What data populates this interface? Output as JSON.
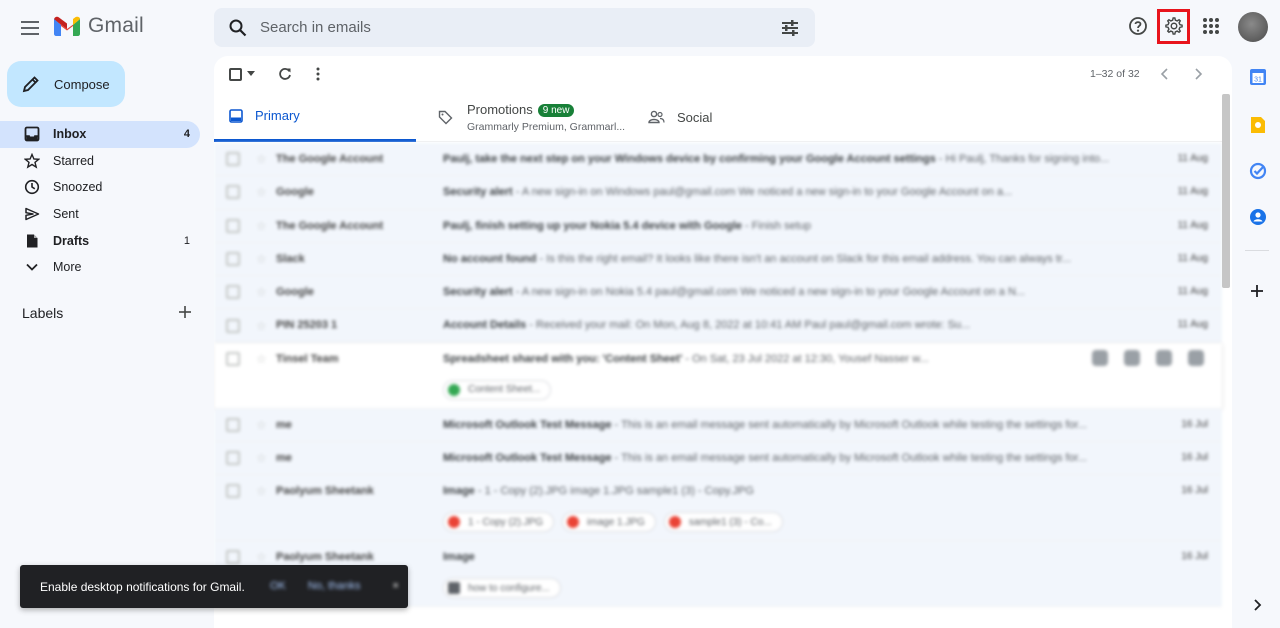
{
  "app": {
    "name": "Gmail"
  },
  "search": {
    "placeholder": "Search in emails"
  },
  "compose": {
    "label": "Compose"
  },
  "sidebar": {
    "items": [
      {
        "label": "Inbox",
        "count": "4",
        "icon": "inbox-icon"
      },
      {
        "label": "Starred",
        "count": "",
        "icon": "star-icon"
      },
      {
        "label": "Snoozed",
        "count": "",
        "icon": "clock-icon"
      },
      {
        "label": "Sent",
        "count": "",
        "icon": "send-icon"
      },
      {
        "label": "Drafts",
        "count": "1",
        "icon": "draft-icon"
      },
      {
        "label": "More",
        "count": "",
        "icon": "chevron-down-icon"
      }
    ],
    "labels_title": "Labels"
  },
  "toolbar": {
    "pager": "1–32 of 32"
  },
  "tabs": {
    "primary": "Primary",
    "promotions": "Promotions",
    "promotions_badge": "9 new",
    "promotions_sub": "Grammarly Premium, Grammarl...",
    "social": "Social"
  },
  "emails": [
    {
      "from": "The Google Account",
      "subject": "Paulj, take the next step on your Windows device by confirming your Google Account settings",
      "snippet": "Hi Paulj, Thanks for signing into...",
      "date": "11 Aug"
    },
    {
      "from": "Google",
      "subject": "Security alert",
      "snippet": "A new sign-in on Windows paul@gmail.com We noticed a new sign-in to your Google Account on a...",
      "date": "11 Aug"
    },
    {
      "from": "The Google Account",
      "subject": "Paulj, finish setting up your Nokia 5.4 device with Google",
      "snippet": "Finish setup",
      "date": "11 Aug"
    },
    {
      "from": "Slack",
      "subject": "No account found",
      "snippet": "Is this the right email? It looks like there isn't an account on Slack for this email address. You can always tr...",
      "date": "11 Aug"
    },
    {
      "from": "Google",
      "subject": "Security alert",
      "snippet": "A new sign-in on Nokia 5.4 paul@gmail.com We noticed a new sign-in to your Google Account on a N...",
      "date": "11 Aug"
    },
    {
      "from": "PIN 25203 1",
      "subject": "Account Details",
      "snippet": "Received your mail: On Mon, Aug 8, 2022 at 10:41 AM Paul paul@gmail.com wrote: Su...",
      "date": "11 Aug"
    },
    {
      "from": "Tinsel Team",
      "subject": "Spreadsheet shared with you: 'Content Sheet'",
      "snippet": "On Sat, 23 Jul 2022 at 12:30, Yousef Nasser w...",
      "date": "",
      "chips": [
        "Content Sheet..."
      ]
    },
    {
      "from": "me",
      "subject": "Microsoft Outlook Test Message",
      "snippet": "This is an email message sent automatically by Microsoft Outlook while testing the settings for...",
      "date": "16 Jul"
    },
    {
      "from": "me",
      "subject": "Microsoft Outlook Test Message",
      "snippet": "This is an email message sent automatically by Microsoft Outlook while testing the settings for...",
      "date": "16 Jul"
    },
    {
      "from": "Paolyum Sheetank",
      "subject": "Image",
      "snippet": "1 - Copy (2).JPG image 1.JPG sample1 (3) - Copy.JPG",
      "date": "16 Jul",
      "chips": [
        "1 - Copy (2).JPG",
        "image 1.JPG",
        "sample1 (3) - Co..."
      ]
    },
    {
      "from": "Paolyum Sheetank",
      "subject": "Image",
      "snippet": "",
      "date": "16 Jul",
      "chips": [
        "how to configure..."
      ]
    }
  ],
  "snackbar": {
    "message": "Enable desktop notifications for Gmail.",
    "ok": "OK",
    "no": "No, thanks"
  },
  "colors": {
    "accent": "#0b57d0",
    "compose_bg": "#c2e7ff",
    "inbox_active": "#d3e3fd",
    "highlight": "#e8141c"
  }
}
